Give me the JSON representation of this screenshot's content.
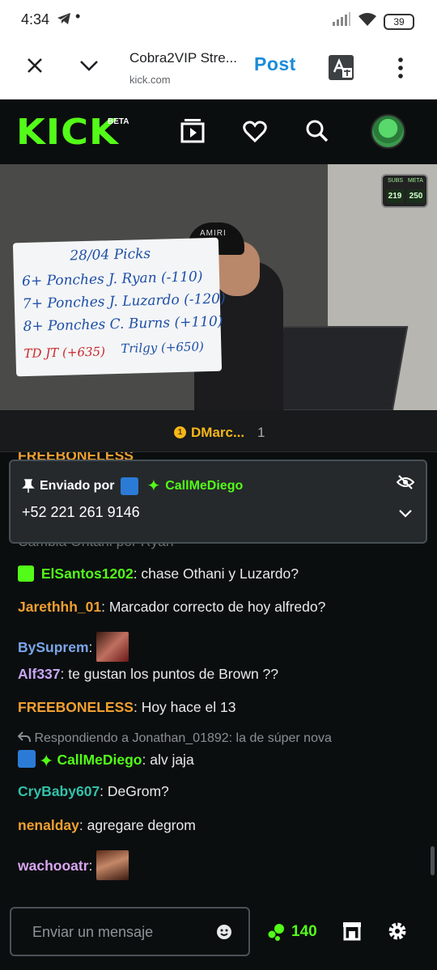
{
  "status_bar": {
    "time": "4:34",
    "dot": "•",
    "battery": "39"
  },
  "browser": {
    "page_title": "Cobra2VIP Stre...",
    "url": "kick.com",
    "post_label": "Post"
  },
  "kick": {
    "logo": "KICK",
    "beta": "BETA"
  },
  "video": {
    "board_lines": [
      "28/04 Picks",
      "6+ Ponches J. Ryan (-110)",
      "7+ Ponches J. Luzardo (-120)",
      "8+ Ponches C. Burns (+110)",
      "TD JT (+635)",
      "Trilgy (+650)"
    ],
    "cap_text": "AMIRI",
    "score_labels": [
      "SUBS",
      "META"
    ],
    "score_values": [
      "219",
      "250"
    ]
  },
  "gifter": {
    "coin": "1",
    "name": "DMarc...",
    "count": "1"
  },
  "pinned": {
    "sent_by": "Enviado por",
    "user": "CallMeDiego",
    "message": "+52 221 261 9146"
  },
  "chat": {
    "top_partial_user": "FREEBONELESS",
    "partial_behind": "Cambia Ohtani por Ryan",
    "messages": [
      {
        "user": "ElSantos1202",
        "text": " chase Othani y Luzardo?",
        "color": "#53fc18"
      },
      {
        "user": "Jarethhh_01",
        "text": " Marcador correcto de hoy alfredo?",
        "color": "#f0a030"
      },
      {
        "user": "BySuprem",
        "text": "",
        "color": "#7aa6e8"
      },
      {
        "user": "Alf337",
        "text": " te gustan los puntos de Brown ??",
        "color": "#c9a6f5"
      },
      {
        "user": "FREEBONELESS",
        "text": " Hoy hace el 13",
        "color": "#f0a030"
      },
      {
        "user": "CallMeDiego",
        "text": " alv jaja",
        "color": "#53fc18"
      },
      {
        "user": "CryBaby607",
        "text": " DeGrom?",
        "color": "#32c0a8"
      },
      {
        "user": "nenalday",
        "text": " agregare degrom",
        "color": "#f0a030"
      },
      {
        "user": "wachooatr",
        "text": "",
        "color": "#d8a6f0"
      }
    ],
    "reply_note": "Respondiendo a Jonathan_01892: la de súper nova",
    "colon": ":"
  },
  "bottom": {
    "placeholder": "Enviar un mensaje",
    "points": "140"
  }
}
